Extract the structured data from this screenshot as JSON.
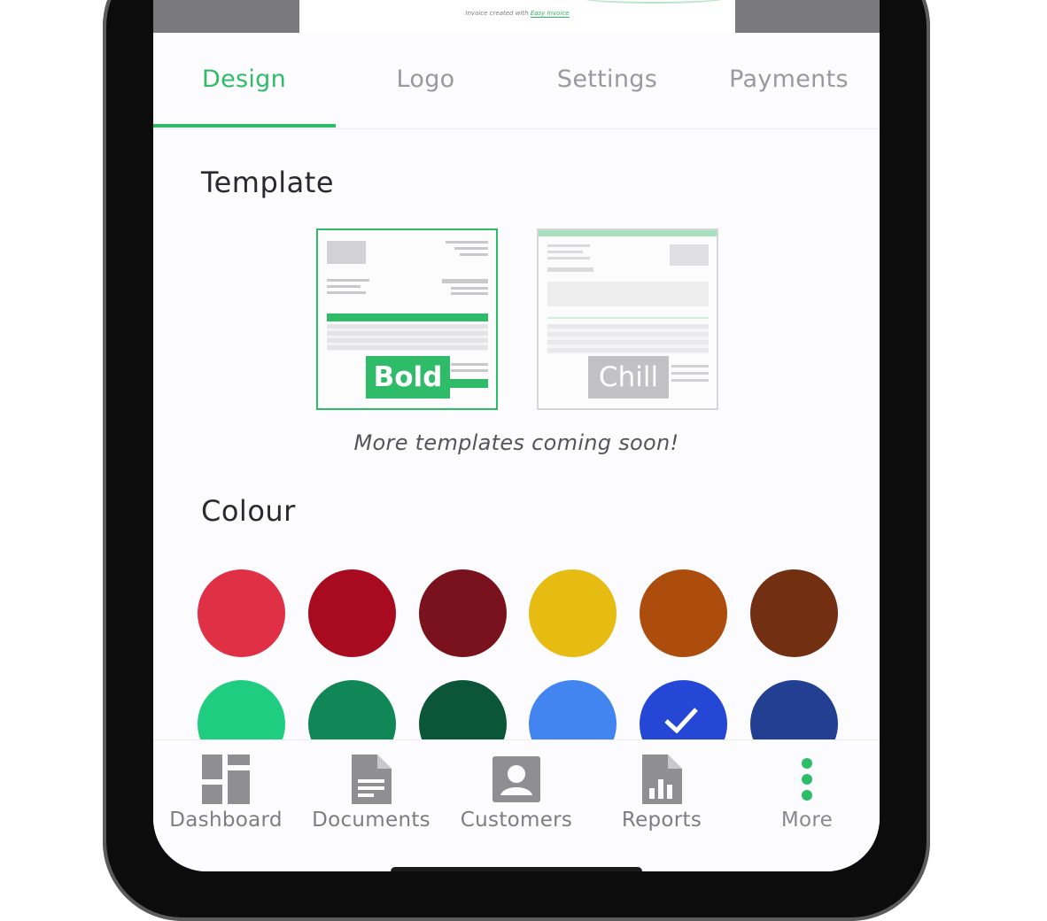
{
  "preview": {
    "footer_text": "Invoice created with",
    "footer_link": "Easy Invoice"
  },
  "tabs": [
    {
      "label": "Design",
      "active": true
    },
    {
      "label": "Logo",
      "active": false
    },
    {
      "label": "Settings",
      "active": false
    },
    {
      "label": "Payments",
      "active": false
    }
  ],
  "template_section": {
    "title": "Template",
    "templates": [
      {
        "label": "Bold",
        "selected": true
      },
      {
        "label": "Chill",
        "selected": false
      }
    ],
    "note": "More templates coming soon!"
  },
  "colour_section": {
    "title": "Colour",
    "swatches": [
      {
        "color": "#df3045",
        "selected": false
      },
      {
        "color": "#a80b1f",
        "selected": false
      },
      {
        "color": "#7a121d",
        "selected": false
      },
      {
        "color": "#e6bb12",
        "selected": false
      },
      {
        "color": "#ac4d0d",
        "selected": false
      },
      {
        "color": "#722f12",
        "selected": false
      },
      {
        "color": "#1ecd80",
        "selected": false
      },
      {
        "color": "#118757",
        "selected": false
      },
      {
        "color": "#0b5639",
        "selected": false
      },
      {
        "color": "#4285f1",
        "selected": false
      },
      {
        "color": "#2447d6",
        "selected": true
      },
      {
        "color": "#233f91",
        "selected": false
      }
    ]
  },
  "bottom_nav": [
    {
      "label": "Dashboard",
      "icon": "dashboard-icon",
      "active": false
    },
    {
      "label": "Documents",
      "icon": "document-icon",
      "active": false
    },
    {
      "label": "Customers",
      "icon": "customer-icon",
      "active": false
    },
    {
      "label": "Reports",
      "icon": "reports-icon",
      "active": false
    },
    {
      "label": "More",
      "icon": "more-dots-icon",
      "active": true
    }
  ],
  "colors": {
    "accent": "#2fbc69",
    "inactive_text": "#9a9a9c",
    "icon_gray": "#8f8e90"
  }
}
